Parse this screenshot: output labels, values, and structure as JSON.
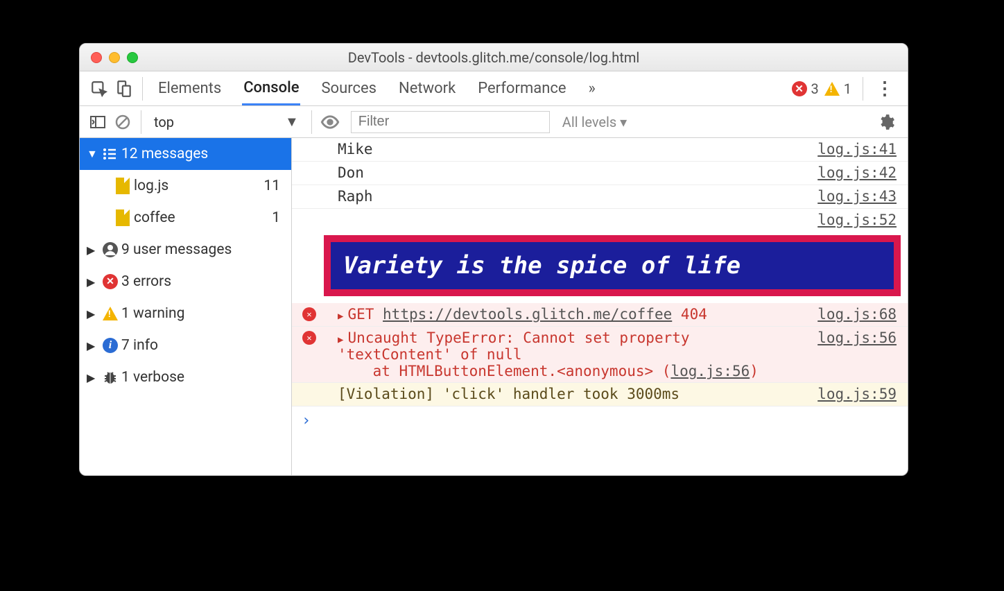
{
  "window_title": "DevTools - devtools.glitch.me/console/log.html",
  "tabs": {
    "elements": "Elements",
    "console": "Console",
    "sources": "Sources",
    "network": "Network",
    "performance": "Performance",
    "more": "»"
  },
  "indicators": {
    "errors": "3",
    "warnings": "1"
  },
  "context": {
    "frame": "top"
  },
  "filter": {
    "placeholder": "Filter",
    "levels": "All levels ▾"
  },
  "sidebar": {
    "messages": {
      "label": "12 messages"
    },
    "files": [
      {
        "name": "log.js",
        "count": "11"
      },
      {
        "name": "coffee",
        "count": "1"
      }
    ],
    "cats": [
      {
        "label": "9 user messages"
      },
      {
        "label": "3 errors"
      },
      {
        "label": "1 warning"
      },
      {
        "label": "7 info"
      },
      {
        "label": "1 verbose"
      }
    ]
  },
  "logs": {
    "mike": {
      "msg": "Mike",
      "src": "log.js:41"
    },
    "don": {
      "msg": "Don",
      "src": "log.js:42"
    },
    "raph": {
      "msg": "Raph",
      "src": "log.js:43"
    },
    "styled": {
      "msg": "Variety is the spice of life",
      "src": "log.js:52"
    },
    "get": {
      "method": "GET",
      "url": "https://devtools.glitch.me/coffee",
      "status": "404",
      "src": "log.js:68"
    },
    "typeerr": {
      "l1": "Uncaught TypeError: Cannot set property",
      "l2": "'textContent' of null",
      "l3": "    at HTMLButtonElement.<anonymous> (",
      "l3link": "log.js:56",
      "l3end": ")",
      "src": "log.js:56"
    },
    "viol": {
      "msg": "[Violation] 'click' handler took 3000ms",
      "src": "log.js:59"
    }
  },
  "prompt": "›"
}
